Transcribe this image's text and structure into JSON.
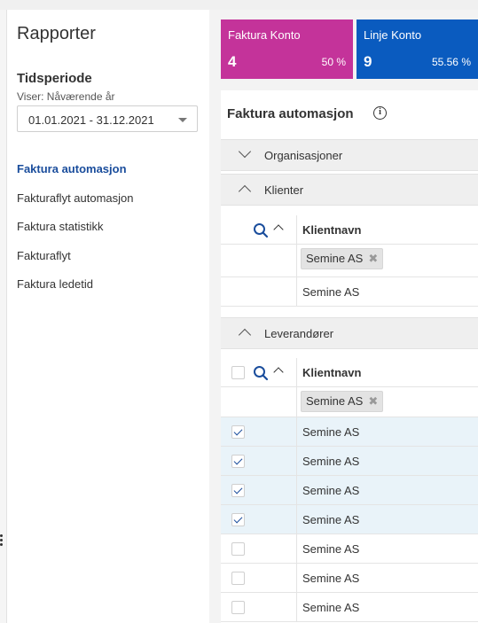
{
  "sidebar": {
    "title": "Rapporter",
    "period_label": "Tidsperiode",
    "period_sub": "Viser: Nåværende år",
    "period_value": "01.01.2021 - 31.12.2021",
    "nav": [
      {
        "label": "Faktura automasjon",
        "active": true
      },
      {
        "label": "Fakturaflyt automasjon",
        "active": false
      },
      {
        "label": "Faktura statistikk",
        "active": false
      },
      {
        "label": "Fakturaflyt",
        "active": false
      },
      {
        "label": "Faktura ledetid",
        "active": false
      }
    ]
  },
  "kpis": [
    {
      "label": "Faktura Konto",
      "value": "4",
      "percent": "50 %",
      "color": "#c4339a"
    },
    {
      "label": "Linje Konto",
      "value": "9",
      "percent": "55.56 %",
      "color": "#0a5bbf"
    }
  ],
  "panel": {
    "title": "Faktura automasjon",
    "sections": {
      "organisations": {
        "label": "Organisasjoner",
        "expanded": false
      },
      "clients": {
        "label": "Klienter",
        "expanded": true,
        "column_header": "Klientnavn",
        "filter_chip": "Semine AS",
        "rows": [
          "Semine AS"
        ]
      },
      "suppliers": {
        "label": "Leverandører",
        "expanded": true,
        "column_header": "Klientnavn",
        "filter_chip": "Semine AS",
        "rows": [
          {
            "name": "Semine AS",
            "checked": true
          },
          {
            "name": "Semine AS",
            "checked": true
          },
          {
            "name": "Semine AS",
            "checked": true
          },
          {
            "name": "Semine AS",
            "checked": true
          },
          {
            "name": "Semine AS",
            "checked": false
          },
          {
            "name": "Semine AS",
            "checked": false
          },
          {
            "name": "Semine AS",
            "checked": false
          }
        ]
      }
    }
  },
  "colors": {
    "accent": "#1a4d9c",
    "selected_row": "#e9f3f9"
  }
}
